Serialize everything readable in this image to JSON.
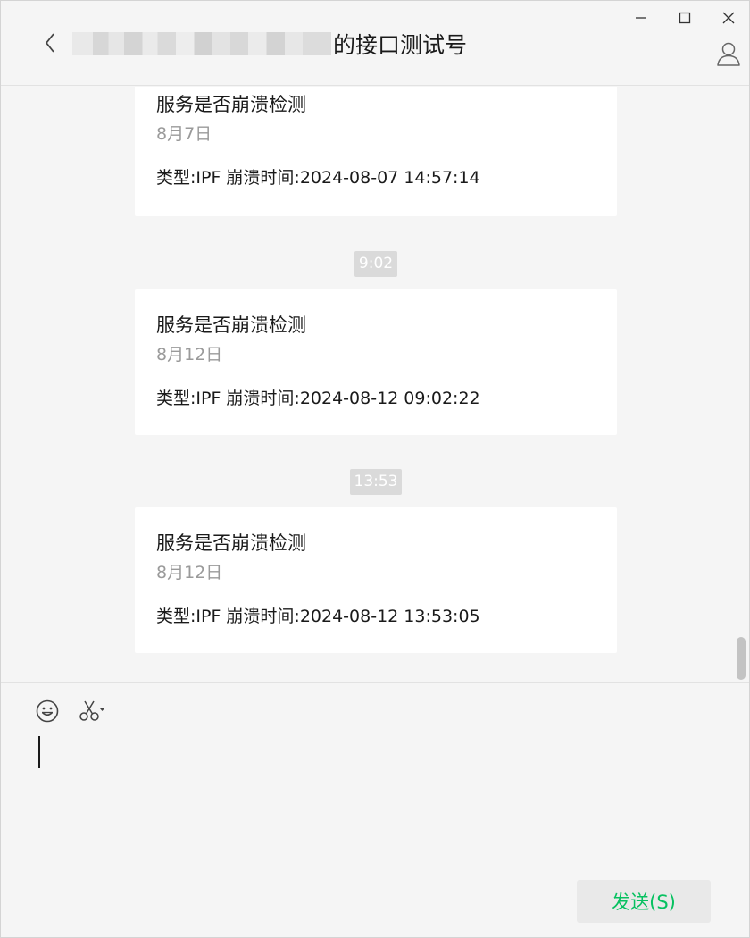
{
  "window": {
    "controls": [
      "minimize-icon",
      "maximize-icon",
      "close-icon"
    ]
  },
  "header": {
    "back_icon": "chevron-left-icon",
    "title_suffix": "的接口测试号",
    "profile_icon": "person-icon"
  },
  "messages": [
    {
      "title": "服务是否崩溃检测",
      "date": "8月7日",
      "body": "类型:IPF 崩溃时间:2024-08-07 14:57:14"
    },
    {
      "timestamp": "9:02",
      "title": "服务是否崩溃检测",
      "date": "8月12日",
      "body": "类型:IPF 崩溃时间:2024-08-12 09:02:22"
    },
    {
      "timestamp": "13:53",
      "title": "服务是否崩溃检测",
      "date": "8月12日",
      "body": "类型:IPF 崩溃时间:2024-08-12 13:53:05"
    }
  ],
  "toolbar": {
    "emoji_icon": "smiley-icon",
    "screenshot_icon": "scissors-icon"
  },
  "input": {
    "value": ""
  },
  "send_button": {
    "label": "发送(S)"
  },
  "colors": {
    "accent": "#07c160",
    "background": "#f5f5f5",
    "card": "#ffffff",
    "timestamp_bg": "#dadada"
  }
}
